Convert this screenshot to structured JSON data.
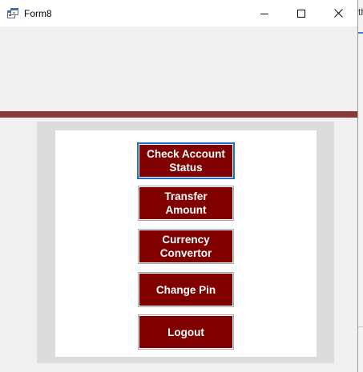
{
  "window": {
    "title": "Form8",
    "icon": "winforms-app-icon",
    "controls": {
      "minimize_icon": "minimize-icon",
      "maximize_icon": "maximize-icon",
      "close_icon": "close-icon"
    }
  },
  "background_window": {
    "partial_text": "th"
  },
  "menu": {
    "buttons": [
      {
        "label": "Check Account\nStatus",
        "focused": true
      },
      {
        "label": "Transfer\nAmount"
      },
      {
        "label": "Currency\nConvertor"
      },
      {
        "label": "Change Pin"
      },
      {
        "label": "Logout"
      }
    ]
  },
  "colors": {
    "window_bg": "#f0f0f0",
    "accent_bar": "#8b3a3a",
    "button_bg": "#800000",
    "button_text": "#ffffff",
    "panel_outer": "#dcdcdc",
    "panel_inner": "#ffffff",
    "focus_border": "#1e6fc4"
  }
}
